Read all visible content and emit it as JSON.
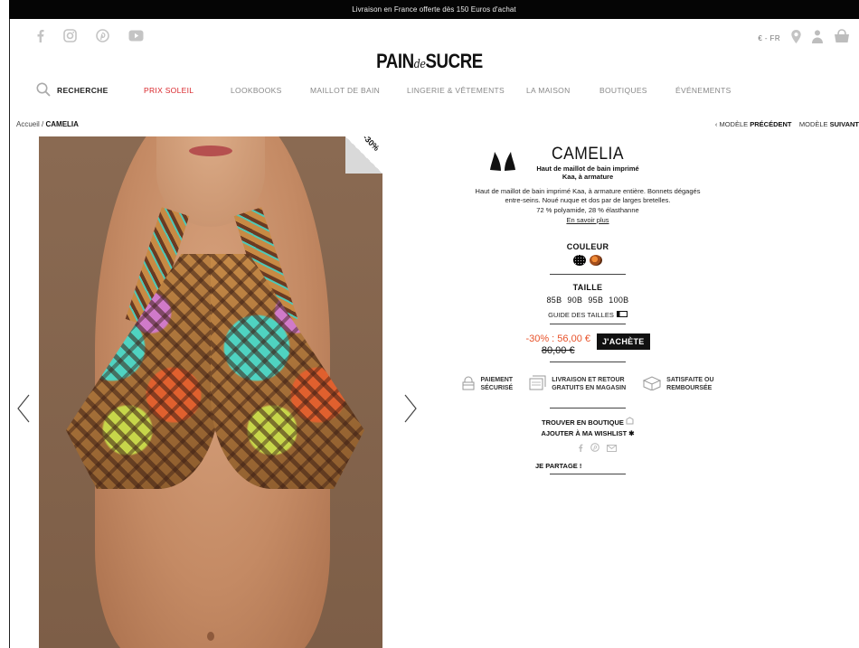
{
  "promo": {
    "text": "Livraison en France offerte dès 150 Euros d'achat"
  },
  "header": {
    "logo": {
      "left": "PAIN",
      "amp": "de",
      "right": "SUCRE"
    },
    "lang": "€ - FR",
    "social_icons": [
      "facebook-icon",
      "instagram-icon",
      "pinterest-icon",
      "youtube-icon"
    ]
  },
  "nav": {
    "search_label": "RECHERCHE",
    "items": [
      {
        "label": "PRIX SOLEIL",
        "active": true
      },
      {
        "label": "LOOKBOOKS"
      },
      {
        "label": "MAILLOT DE BAIN"
      },
      {
        "label": "LINGERIE & VÊTEMENTS"
      },
      {
        "label": "LA MAISON"
      },
      {
        "label": "BOUTIQUES"
      },
      {
        "label": "ÉVÉNEMENTS"
      }
    ]
  },
  "breadcrumb": {
    "home": "Accueil",
    "separator": " / ",
    "current": "CAMELIA"
  },
  "pager": {
    "prev_prefix": "MODÈLE ",
    "prev_bold": "PRÉCÉDENT",
    "next_prefix": "MODÈLE ",
    "next_bold": "SUIVANT"
  },
  "product": {
    "discount_badge": "-30%",
    "name": "CAMELIA",
    "subtitle_line1": "Haut de maillot de bain imprimé",
    "subtitle_line2": "Kaa, à armature",
    "description": "Haut de maillot de bain imprimé Kaa, à armature entière. Bonnets dégagés entre-seins. Noué nuque et dos par de larges bretelles.",
    "composition": "72 % polyamide, 28 % élasthanne",
    "more_link": "En savoir plus",
    "color_label": "COULEUR",
    "size_label": "TAILLE",
    "sizes": [
      "85B",
      "90B",
      "95B",
      "100B"
    ],
    "size_guide": "GUIDE DES TAILLES",
    "price_new": "-30% : 56,00 €",
    "price_old": "80,00 €",
    "buy_label": "J'ACHÈTE",
    "guarantees": [
      {
        "line1": "PAIEMENT",
        "line2": "SÉCURISÉ"
      },
      {
        "line1": "LIVRAISON ET RETOUR",
        "line2": "GRATUITS EN MAGASIN"
      },
      {
        "line1": "SATISFAITE OU",
        "line2": "REMBOURSÉE"
      }
    ],
    "find_store": "TROUVER EN BOUTIQUE",
    "wishlist": "AJOUTER À MA WISHLIST",
    "share_label": "JE PARTAGE !"
  },
  "colors": {
    "accent": "#d9262b",
    "price": "#e8532b",
    "text": "#111111"
  }
}
